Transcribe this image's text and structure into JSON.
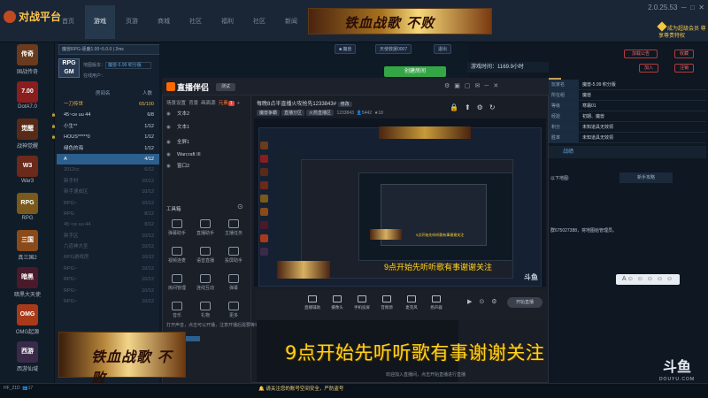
{
  "host": {
    "logo": "对战平台",
    "nav_tabs": [
      "首页",
      "游戏",
      "页游",
      "商城",
      "社区",
      "福利",
      "社区",
      "新闻"
    ],
    "active_tab_index": 1,
    "banner_text": "铁血战歌 不败",
    "version": "2.0.25.53",
    "badge": "成为超级会员 尊享尊贵特权",
    "games": [
      {
        "label": "国战传奇",
        "icon": "传奇",
        "color": "#6a3b1c"
      },
      {
        "label": "DotA7.0",
        "icon": "7.00",
        "color": "#8a1e1e"
      },
      {
        "label": "战神觉醒",
        "icon": "觉醒",
        "color": "#5a2a18"
      },
      {
        "label": "War3",
        "icon": "W3",
        "color": "#6b2a1a"
      },
      {
        "label": "RPG",
        "icon": "RPG",
        "color": "#7a5a1a"
      },
      {
        "label": "真三国2",
        "icon": "三国",
        "color": "#8a4a1a"
      },
      {
        "label": "暗黑大天使",
        "icon": "暗黑",
        "color": "#4a1a2a"
      },
      {
        "label": "OMG起源",
        "icon": "OMG",
        "color": "#a83a1a"
      },
      {
        "label": "西游仙域",
        "icon": "西游",
        "color": "#3a2a4a"
      }
    ],
    "room_header": "魔兽RPG-逐鹿1.00~5.0.0 | 2ms",
    "map_label": "地图版本：",
    "map_value": "魔兽-5.99 积分版",
    "online_label": "在线用户：",
    "room_list_header": [
      "房间名",
      "人数"
    ],
    "rooms": [
      {
        "name": "一刀传世",
        "count": "65/100",
        "sel": false,
        "dim": false,
        "lock": false,
        "hl": true
      },
      {
        "name": "45~ce uu 44",
        "count": "6/8",
        "sel": false,
        "dim": false,
        "lock": true,
        "hl": false
      },
      {
        "name": "小生**",
        "count": "1/12",
        "sel": false,
        "dim": false,
        "lock": true,
        "hl": false
      },
      {
        "name": "HOUS*****0",
        "count": "1/12",
        "sel": false,
        "dim": false,
        "lock": true,
        "hl": false
      },
      {
        "name": "绿色的海",
        "count": "1/12",
        "sel": false,
        "dim": false,
        "lock": false,
        "hl": false
      },
      {
        "name": "A",
        "count": "4/12",
        "sel": true,
        "dim": false,
        "lock": false,
        "hl": false
      },
      {
        "name": "2012cc",
        "count": "6/12",
        "sel": false,
        "dim": true,
        "lock": false,
        "hl": false
      },
      {
        "name": "新手村",
        "count": "10/12",
        "sel": false,
        "dim": true,
        "lock": false,
        "hl": false
      },
      {
        "name": "新手速成区",
        "count": "10/12",
        "sel": false,
        "dim": true,
        "lock": false,
        "hl": false
      },
      {
        "name": "RPG~",
        "count": "10/12",
        "sel": false,
        "dim": true,
        "lock": false,
        "hl": false
      },
      {
        "name": "RPG",
        "count": "8/12",
        "sel": false,
        "dim": true,
        "lock": false,
        "hl": false
      },
      {
        "name": "45~ce uu 44",
        "count": "8/12",
        "sel": false,
        "dim": true,
        "lock": false,
        "hl": false
      },
      {
        "name": "新手区",
        "count": "10/12",
        "sel": false,
        "dim": true,
        "lock": false,
        "hl": false
      },
      {
        "name": "六道神大圣",
        "count": "10/12",
        "sel": false,
        "dim": true,
        "lock": false,
        "hl": false
      },
      {
        "name": "RPG游戏房",
        "count": "10/12",
        "sel": false,
        "dim": true,
        "lock": false,
        "hl": false
      },
      {
        "name": "RPG~",
        "count": "10/12",
        "sel": false,
        "dim": true,
        "lock": false,
        "hl": false
      },
      {
        "name": "RPG~",
        "count": "10/12",
        "sel": false,
        "dim": true,
        "lock": false,
        "hl": false
      },
      {
        "name": "RPG~",
        "count": "10/12",
        "sel": false,
        "dim": true,
        "lock": false,
        "hl": false
      },
      {
        "name": "RPG~",
        "count": "10/12",
        "sel": false,
        "dim": true,
        "lock": false,
        "hl": false
      }
    ],
    "tool_pills": [
      "天使救援0007",
      "退出"
    ],
    "green_button": "创建房间",
    "timer_label": "游戏时间：",
    "timer_value": "1169.9小时",
    "rp_buttons": [
      "加入",
      "注销",
      "收藏"
    ],
    "rp_top_button": "加载公告",
    "stats": [
      {
        "k": "玩家名",
        "v": "魔兽-5.99 积分版"
      },
      {
        "k": "所在组",
        "v": "魔兽"
      },
      {
        "k": "等级",
        "v": "寒霜01"
      },
      {
        "k": "经验",
        "v": "初期、魔兽"
      },
      {
        "k": "积分",
        "v": "未知道具无效领"
      },
      {
        "k": "胜率",
        "v": "未知道具无效领"
      }
    ],
    "rp_tab": "战绩",
    "rp_tab2": "新手攻略",
    "rp_text1": "以下地图:",
    "rp_text2": "群675027388，将地图给管理员。",
    "emoji_bar": "A☺ ☺ ☺ ☺ ☺",
    "user": "HF_21D",
    "user_count": "17",
    "tray_note": "请关注您的账号空间安全，严防盗号",
    "task_apps": [
      "",
      "直播伴侣"
    ]
  },
  "obs": {
    "logo": "直播伴侣",
    "version": "测试",
    "left_tabs": [
      "场景设置",
      "背景",
      "画面源",
      "元素"
    ],
    "left_badge": "1",
    "scenes": [
      {
        "label": "文本2",
        "y": 0
      },
      {
        "label": "文本1",
        "y": 1
      },
      {
        "label": "全屏1",
        "y": 2
      },
      {
        "label": "Warcraft III",
        "y": 3
      },
      {
        "label": "窗口2",
        "y": 4
      }
    ],
    "tool_tab": "工具箱",
    "tools": [
      {
        "label": "弹幕助手"
      },
      {
        "label": "直播助手"
      },
      {
        "label": "主播任务"
      },
      {
        "label": "视频连麦"
      },
      {
        "label": "语音直播"
      },
      {
        "label": "投屏助手"
      },
      {
        "label": "房间管理"
      },
      {
        "label": "连线互动"
      },
      {
        "label": "弹幕"
      },
      {
        "label": "音乐"
      },
      {
        "label": "礼物"
      },
      {
        "label": "更多"
      }
    ],
    "info_title": "每晚8点半直播火攻抢先1233843#",
    "info_edit": "修改",
    "info_tags": [
      "魔兽争霸",
      "直播分区",
      "火箭直播区"
    ],
    "info_id": "1233843",
    "info_fans": "5442",
    "info_lv": "18",
    "controls": [
      {
        "label": "直播辅助"
      },
      {
        "label": "摄像头"
      },
      {
        "label": "手机投屏"
      },
      {
        "label": "音频源"
      },
      {
        "label": "麦克风"
      },
      {
        "label": "扬声器"
      }
    ],
    "golive": "开始直播",
    "chat_hint": "欢迎加入直播间，点击开始直播进行直播",
    "left_footer": "打开声音，点击可以开播，注意开播后需要等待一段时间后方可",
    "nested_caption": "9点开始先听听歌有事谢谢关注",
    "nested_caption_small": "9点开始先听听歌有事谢谢关注",
    "nested_brand": "斗鱼"
  },
  "overlay": {
    "big_caption": "9点开始先听听歌有事谢谢关注",
    "bottom_banner": "铁血战歌 不败",
    "douyu": "斗鱼",
    "douyu_url": "DOUYU.COM"
  }
}
